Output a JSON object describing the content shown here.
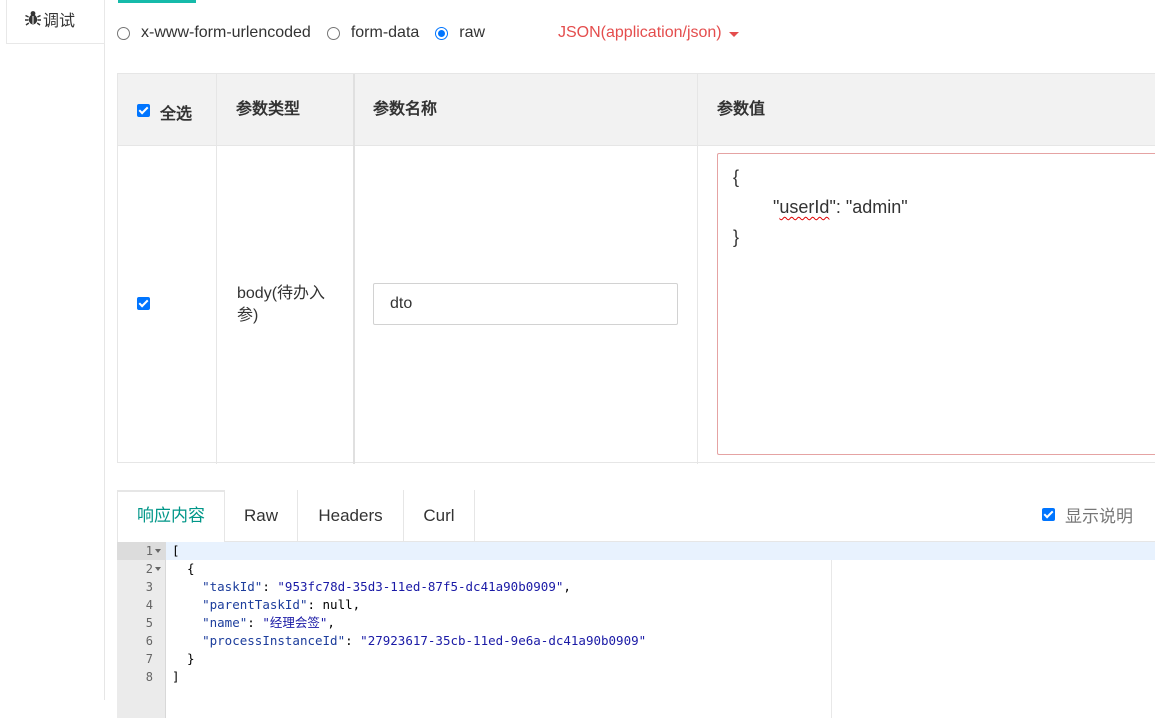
{
  "left_tab": {
    "label": "调试",
    "icon": "bug-icon"
  },
  "body_types": {
    "options": [
      {
        "label": "x-www-form-urlencoded",
        "checked": false
      },
      {
        "label": "form-data",
        "checked": false
      },
      {
        "label": "raw",
        "checked": true
      }
    ],
    "content_type": "JSON(application/json)"
  },
  "params_table": {
    "headers": {
      "select_all": "全选",
      "type": "参数类型",
      "name": "参数名称",
      "value": "参数值"
    },
    "row": {
      "checked": true,
      "type": "body(待办入参)",
      "name": "dto",
      "value_lines": [
        "{",
        "        \"",
        "}"
      ],
      "value_key": "userId",
      "value_rest": "\": \"admin\""
    }
  },
  "response_tabs": {
    "tabs": [
      "响应内容",
      "Raw",
      "Headers",
      "Curl"
    ],
    "active": "响应内容",
    "show_desc_label": "显示说明",
    "show_desc_checked": true
  },
  "editor": {
    "line_numbers": [
      "1",
      "2",
      "3",
      "4",
      "5",
      "6",
      "7",
      "8"
    ],
    "lines": [
      "[",
      "  {",
      "    \"taskId\": \"953fc78d-35d3-11ed-87f5-dc41a90b0909\",",
      "    \"parentTaskId\": null,",
      "    \"name\": \"经理会签\",",
      "    \"processInstanceId\": \"27923617-35cb-11ed-9e6a-dc41a90b0909\"",
      "  }",
      "]"
    ],
    "response": [
      {
        "taskId": "953fc78d-35d3-11ed-87f5-dc41a90b0909",
        "parentTaskId": "null",
        "name": "经理会签",
        "processInstanceId": "27923617-35cb-11ed-9e6a-dc41a90b0909"
      }
    ]
  },
  "colors": {
    "accent": "#009688",
    "content_type": "#e44d4d",
    "checkbox": "#0075ff"
  }
}
